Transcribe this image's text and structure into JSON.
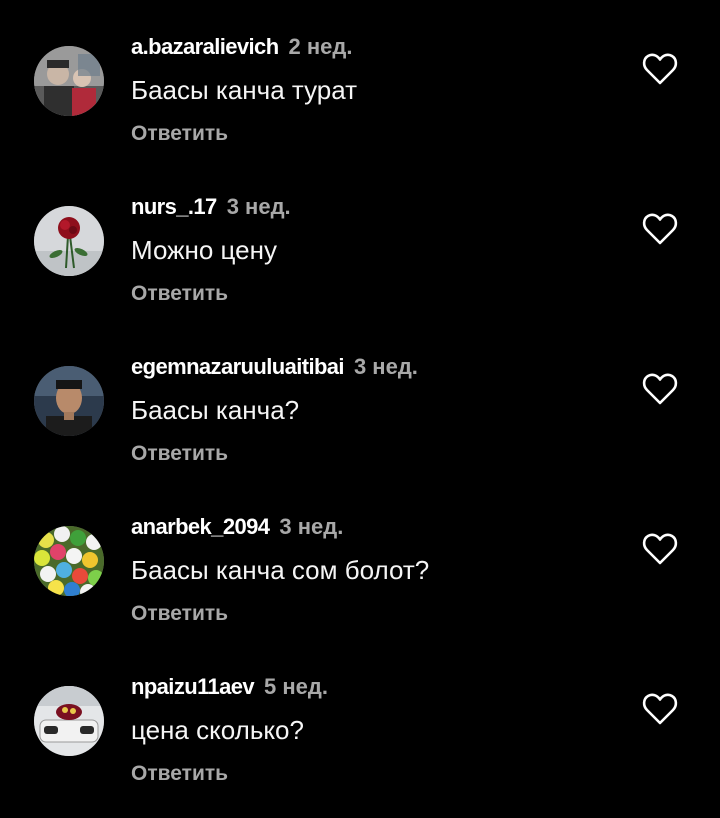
{
  "comments": [
    {
      "username": "a.bazaralievich",
      "time": "2 нед.",
      "text": "Баасы канча турат",
      "reply_label": "Ответить"
    },
    {
      "username": "nurs_.17",
      "time": "3 нед.",
      "text": "Можно цену",
      "reply_label": "Ответить"
    },
    {
      "username": "egemnazaruuluaitibai",
      "time": "3 нед.",
      "text": "Баасы канча?",
      "reply_label": "Ответить"
    },
    {
      "username": "anarbek_2094",
      "time": "3 нед.",
      "text": "Баасы канча сом болот?",
      "reply_label": "Ответить"
    },
    {
      "username": "npaizu11aev",
      "time": "5 нед.",
      "text": "цена сколько?",
      "reply_label": "Ответить"
    }
  ],
  "icons": {
    "like": "heart-outline-icon"
  },
  "colors": {
    "background": "#000000",
    "text": "#ffffff",
    "secondary_text": "#a8a8a8"
  }
}
